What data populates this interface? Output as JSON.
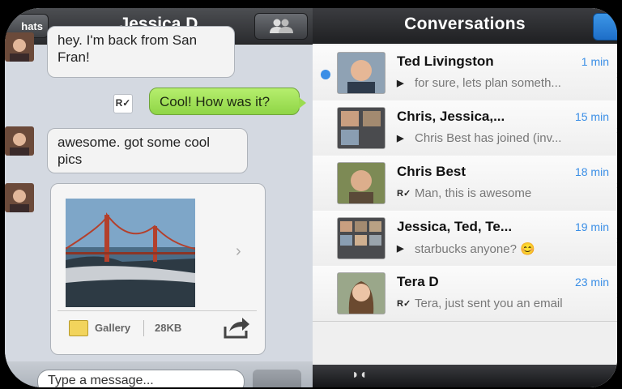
{
  "chat": {
    "back_label": "hats",
    "title": "Jessica D",
    "messages": [
      {
        "text": "hey. I'm back from San Fran!"
      },
      {
        "text": "Cool! How was it?"
      },
      {
        "text": "awesome. got some cool pics"
      }
    ],
    "receipt_mark": "R✓",
    "media": {
      "gallery_label": "Gallery",
      "size": "28KB"
    },
    "composer_placeholder": "Type a message..."
  },
  "conversations": {
    "title": "Conversations",
    "items": [
      {
        "name": "Ted Livingston",
        "time": "1 min",
        "mark": "▶",
        "preview": "for sure, lets plan someth...",
        "unread": true
      },
      {
        "name": "Chris, Jessica,...",
        "time": "15 min",
        "mark": "▶",
        "preview": "Chris Best has joined (inv...",
        "unread": false
      },
      {
        "name": "Chris Best",
        "time": "18 min",
        "mark": "R✓",
        "preview": "Man, this is awesome",
        "unread": false
      },
      {
        "name": "Jessica, Ted, Te...",
        "time": "19 min",
        "mark": "▶",
        "preview": "starbucks anyone? 😊",
        "unread": false
      },
      {
        "name": "Tera D",
        "time": "23 min",
        "mark": "R✓",
        "preview": "Tera, just sent you an email",
        "unread": false
      }
    ]
  },
  "colors": {
    "accent_blue": "#3a8ee6",
    "outgoing_bubble": "#9bdc50",
    "nav_dark": "#2a2b2e"
  }
}
